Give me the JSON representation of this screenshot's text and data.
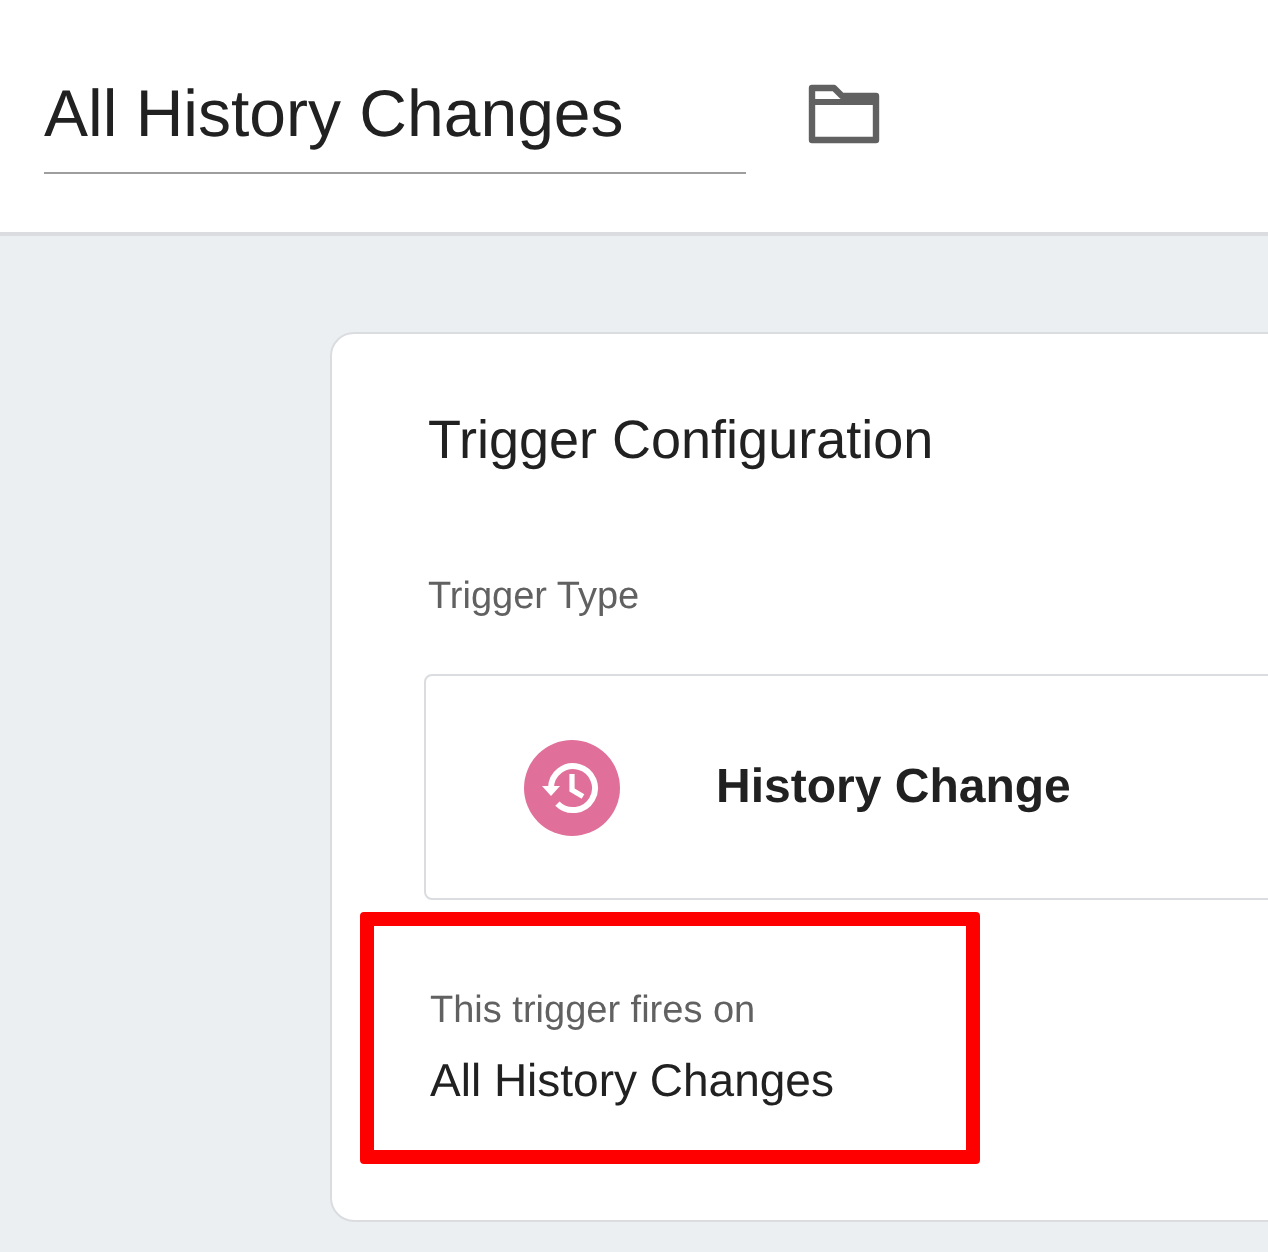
{
  "header": {
    "title": "All History Changes"
  },
  "card": {
    "title": "Trigger Configuration",
    "trigger_type_label": "Trigger Type",
    "trigger_type": "History Change",
    "fires_on_label": "This trigger fires on",
    "fires_on_value": "All History Changes"
  }
}
